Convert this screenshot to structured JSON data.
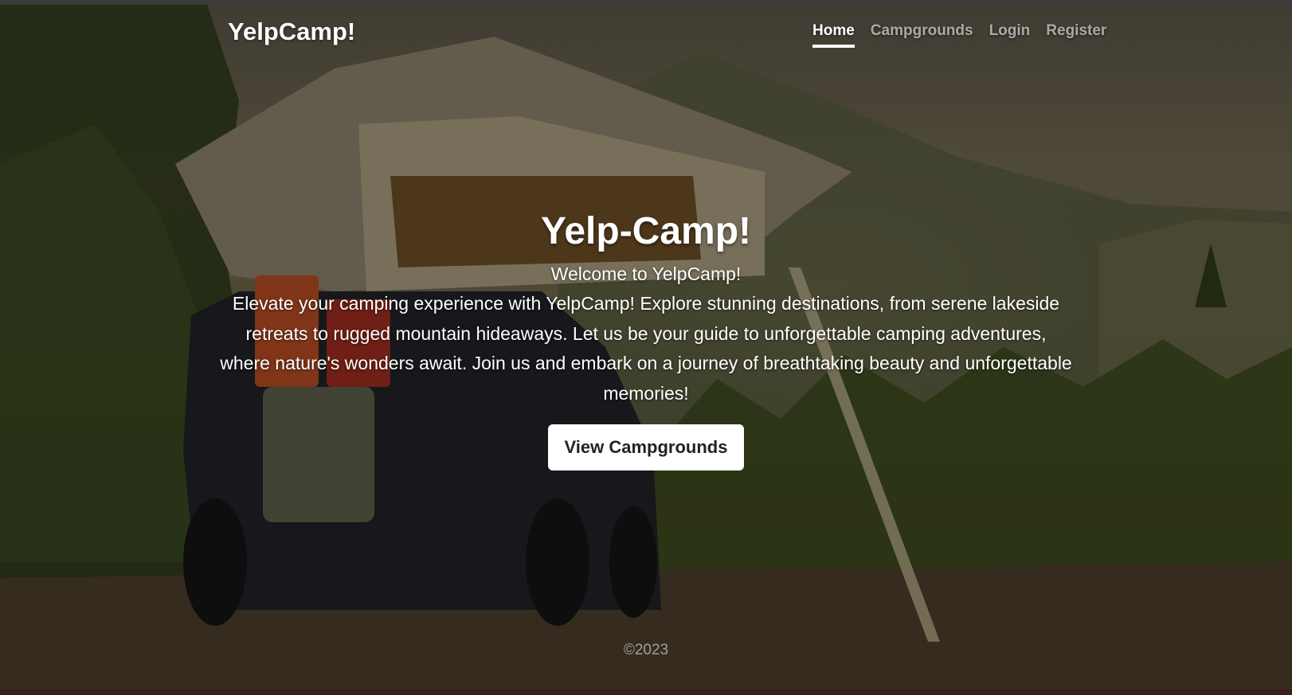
{
  "nav": {
    "brand": "YelpCamp!",
    "links": [
      {
        "label": "Home",
        "active": true
      },
      {
        "label": "Campgrounds",
        "active": false
      },
      {
        "label": "Login",
        "active": false
      },
      {
        "label": "Register",
        "active": false
      }
    ]
  },
  "hero": {
    "title": "Yelp-Camp!",
    "subtitle": "Welcome to YelpCamp!",
    "description": "Elevate your camping experience with YelpCamp! Explore stunning destinations, from serene lakeside retreats to rugged mountain hideaways. Let us be your guide to unforgettable camping adventures, where nature's wonders await. Join us and embark on a journey of breathtaking beauty and unforgettable memories!",
    "button_label": "View Campgrounds"
  },
  "footer": {
    "text": "©2023"
  },
  "colors": {
    "overlay": "#000000",
    "text": "#ffffff",
    "button_bg": "#ffffff",
    "button_text": "#222222"
  }
}
